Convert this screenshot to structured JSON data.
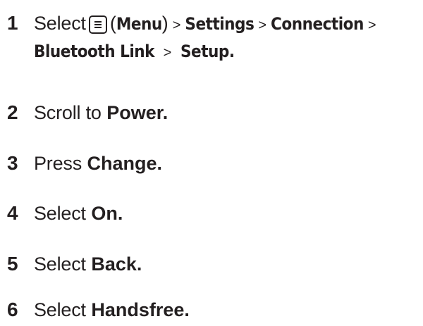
{
  "steps": [
    {
      "number": "1",
      "select_word": "Select",
      "menu_label": "Menu",
      "path": [
        "Settings",
        "Connection",
        "Bluetooth Link",
        "Setup."
      ]
    },
    {
      "number": "2",
      "verb": "Scroll to",
      "target": "Power."
    },
    {
      "number": "3",
      "verb": "Press",
      "target": "Change."
    },
    {
      "number": "4",
      "verb": "Select",
      "target": "On."
    },
    {
      "number": "5",
      "verb": "Select",
      "target": "Back."
    },
    {
      "number": "6",
      "verb": "Select",
      "target": "Handsfree."
    }
  ],
  "separator": ">",
  "icons": {
    "menu": "menu-key-icon"
  },
  "colors": {
    "text": "#231f20"
  }
}
